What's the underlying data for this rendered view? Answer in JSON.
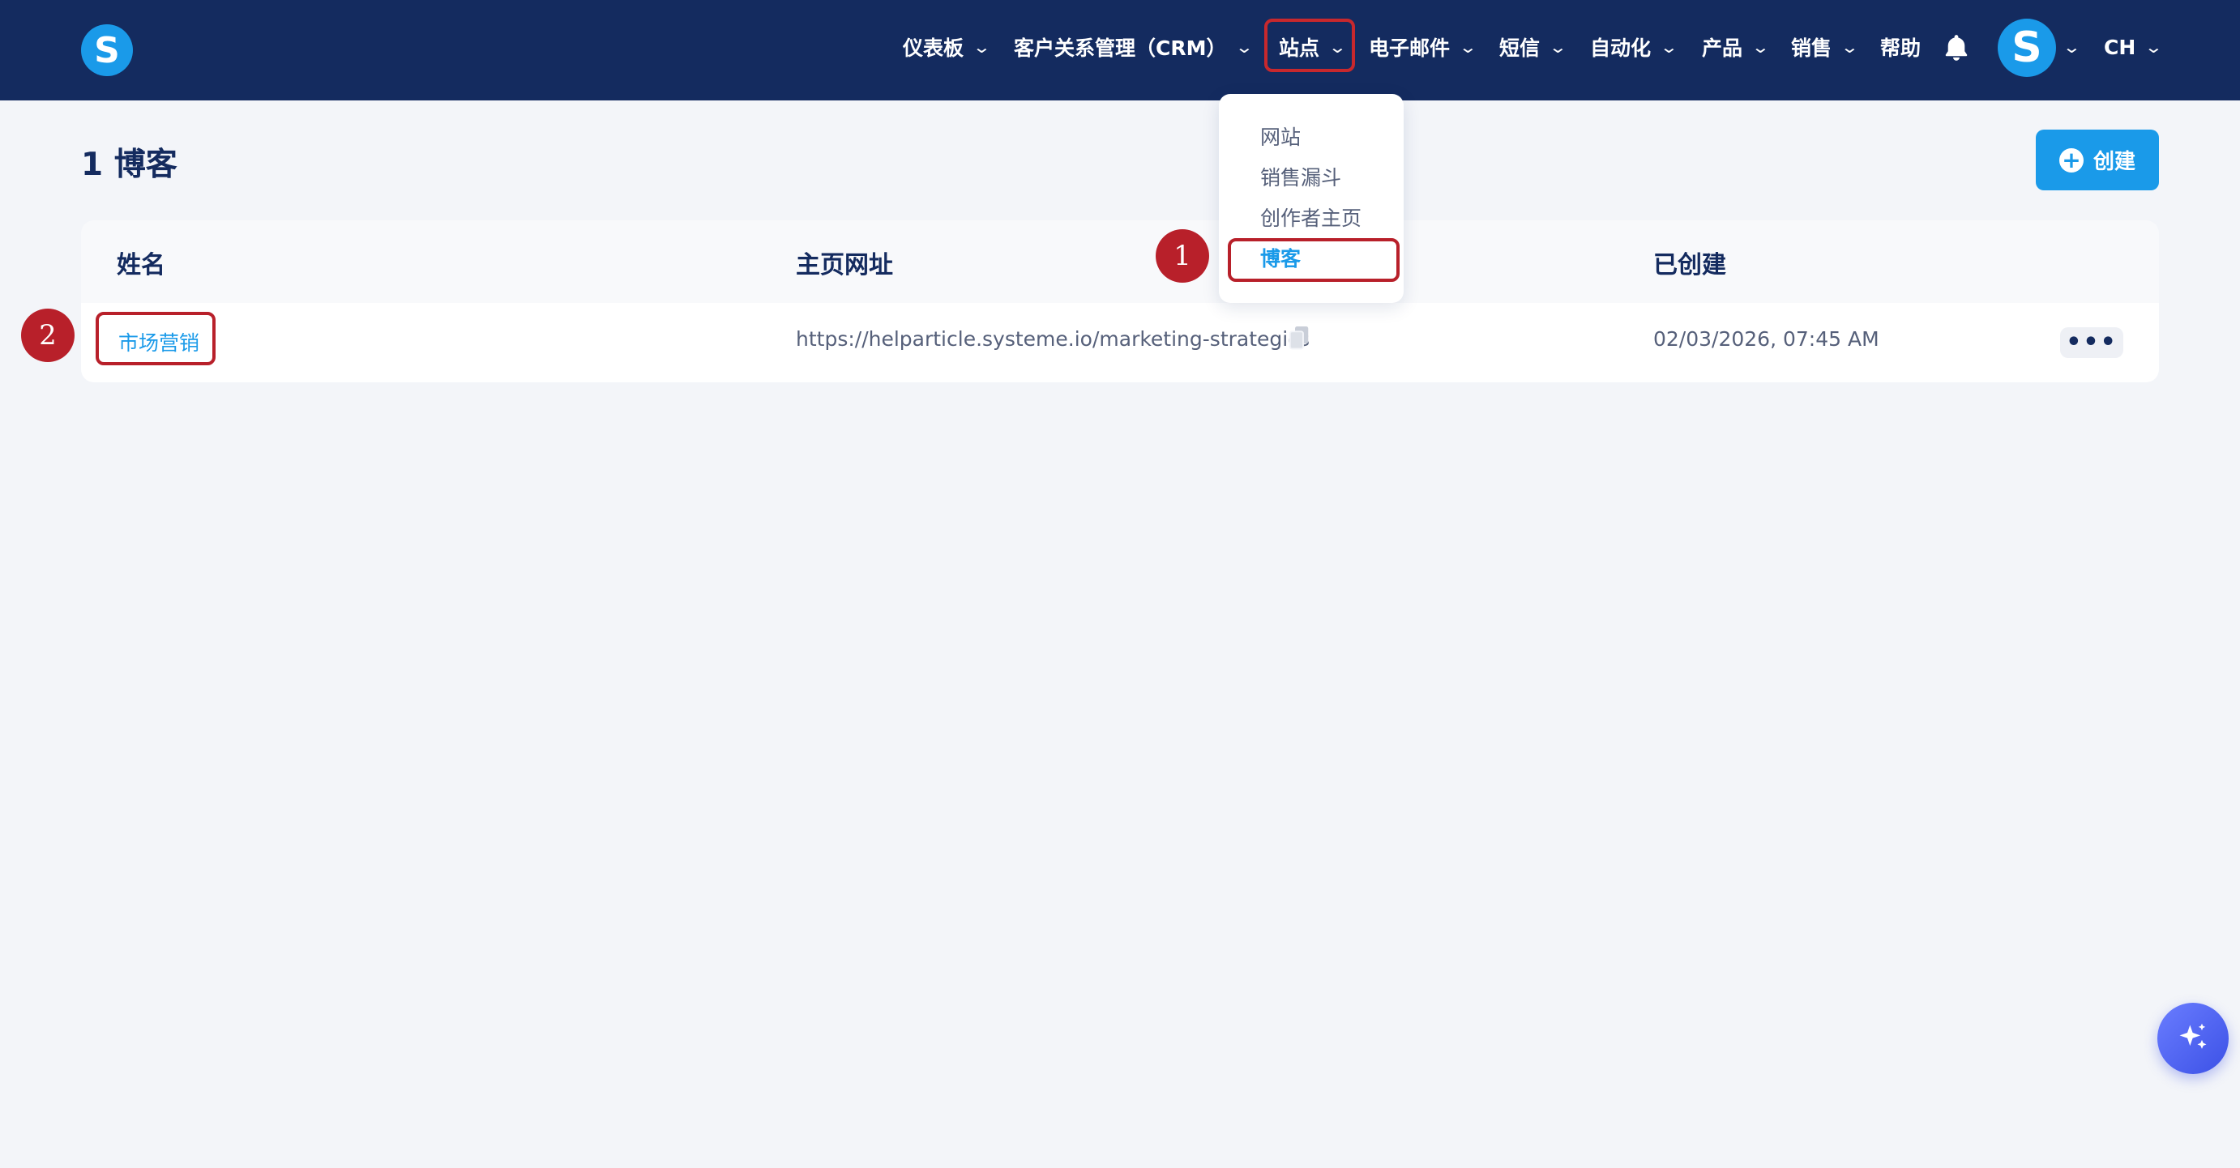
{
  "header": {
    "logo_letter": "S",
    "nav": [
      {
        "label": "仪表板"
      },
      {
        "label": "客户关系管理（CRM）"
      },
      {
        "label": "站点"
      },
      {
        "label": "电子邮件"
      },
      {
        "label": "短信"
      },
      {
        "label": "自动化"
      },
      {
        "label": "产品"
      },
      {
        "label": "销售"
      },
      {
        "label": "帮助"
      }
    ],
    "avatar_letter": "S",
    "language": "CH"
  },
  "dropdown": {
    "items": [
      {
        "label": "网站"
      },
      {
        "label": "销售漏斗"
      },
      {
        "label": "创作者主页"
      },
      {
        "label": "博客"
      }
    ],
    "active_item": "博客"
  },
  "annotations": {
    "step1": "1",
    "step2": "2"
  },
  "page": {
    "title": "1 博客",
    "create_label": "创建"
  },
  "table": {
    "headers": [
      "姓名",
      "主页网址",
      "已创建"
    ],
    "rows": [
      {
        "name": "市场营销",
        "url": "https://helparticle.systeme.io/marketing-strategics",
        "created": "02/03/2026, 07:45 AM"
      }
    ]
  },
  "icons": {
    "bell": "bell-icon",
    "copy": "copy-icon",
    "more": "more-icon",
    "ai": "sparkle-icon",
    "plus": "plus-circle-icon",
    "chevron": "chevron-down-icon"
  },
  "colors": {
    "topbar": "#142b5f",
    "accent": "#1a9ae9",
    "annotation": "#b8202a",
    "background": "#f3f5f9"
  }
}
